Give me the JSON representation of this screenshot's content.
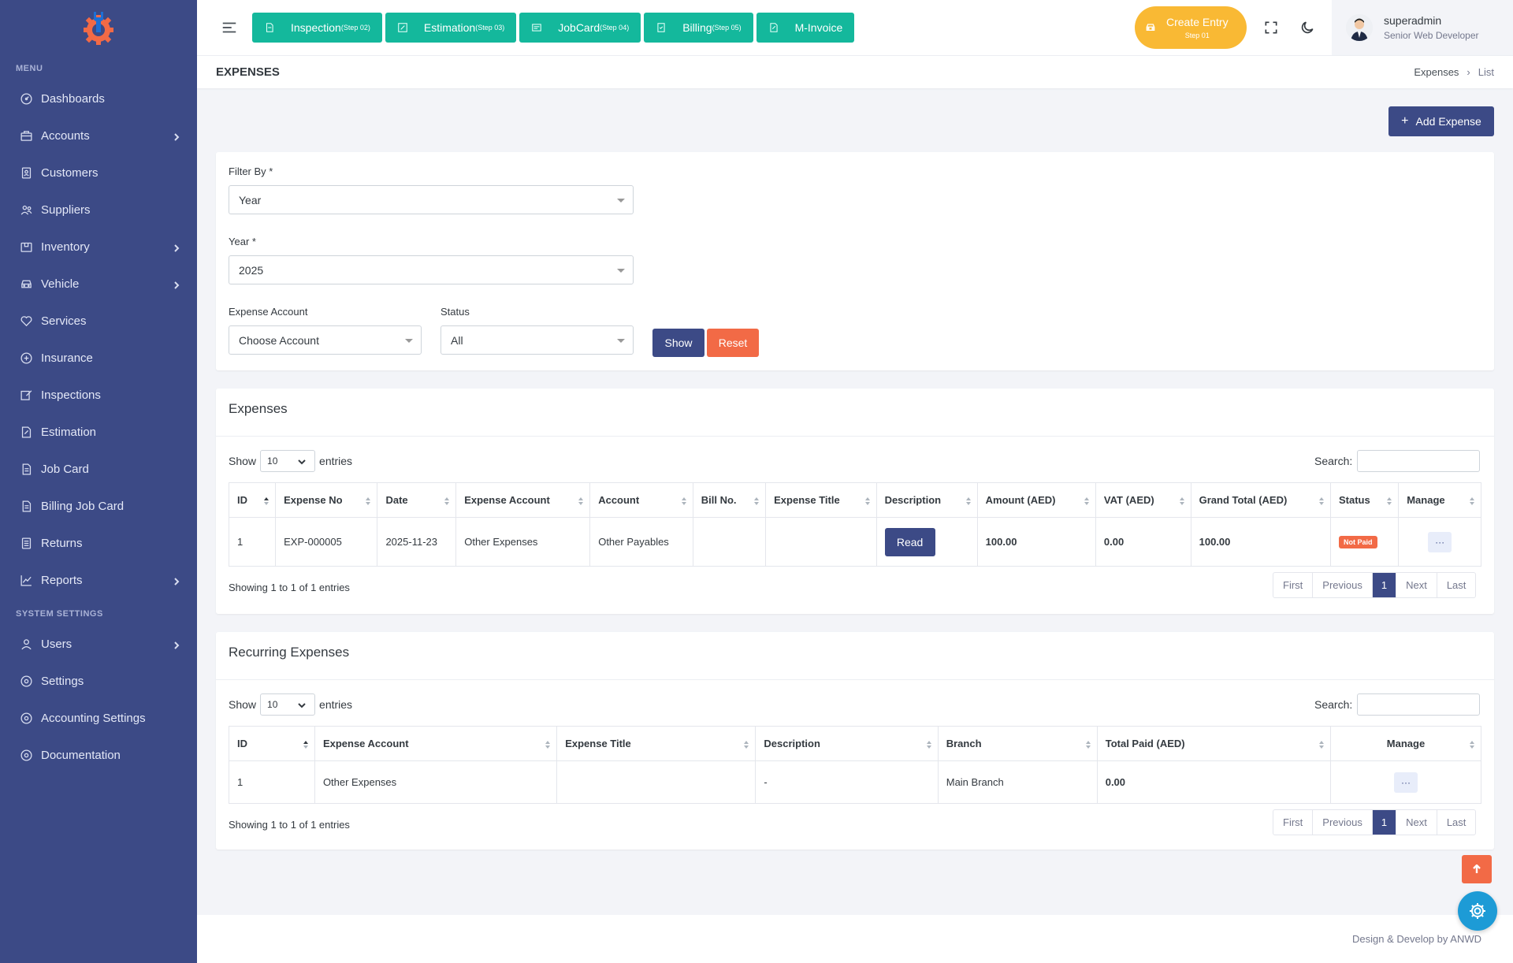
{
  "sidebar": {
    "menu_title": "MENU",
    "system_title": "SYSTEM SETTINGS",
    "items": [
      {
        "label": "Dashboards",
        "icon": "dashboard-icon",
        "has_sub": false
      },
      {
        "label": "Accounts",
        "icon": "briefcase-icon",
        "has_sub": true
      },
      {
        "label": "Customers",
        "icon": "contact-book-icon",
        "has_sub": false
      },
      {
        "label": "Suppliers",
        "icon": "users-group-icon",
        "has_sub": false
      },
      {
        "label": "Inventory",
        "icon": "box-icon",
        "has_sub": true
      },
      {
        "label": "Vehicle",
        "icon": "car-icon",
        "has_sub": true
      },
      {
        "label": "Services",
        "icon": "heart-icon",
        "has_sub": false
      },
      {
        "label": "Insurance",
        "icon": "insurance-icon",
        "has_sub": false
      },
      {
        "label": "Inspections",
        "icon": "edit-box-icon",
        "has_sub": false
      },
      {
        "label": "Estimation",
        "icon": "edit-note-icon",
        "has_sub": false
      },
      {
        "label": "Job Card",
        "icon": "document-icon",
        "has_sub": false
      },
      {
        "label": "Billing Job Card",
        "icon": "document-icon",
        "has_sub": false
      },
      {
        "label": "Returns",
        "icon": "list-icon",
        "has_sub": false
      },
      {
        "label": "Reports",
        "icon": "chart-line-icon",
        "has_sub": true
      }
    ],
    "system_items": [
      {
        "label": "Users",
        "icon": "user-icon",
        "has_sub": true
      },
      {
        "label": "Settings",
        "icon": "settings-icon",
        "has_sub": false
      },
      {
        "label": "Accounting Settings",
        "icon": "settings-icon",
        "has_sub": false
      },
      {
        "label": "Documentation",
        "icon": "settings-icon",
        "has_sub": false
      }
    ]
  },
  "topbar": {
    "steps": [
      {
        "label": "Inspection",
        "step": "(Step 02)"
      },
      {
        "label": "Estimation",
        "step": "(Step 03)"
      },
      {
        "label": "JobCard",
        "step": "(Step 04)"
      },
      {
        "label": "Billing",
        "step": "(Step 05)"
      },
      {
        "label": "M-Invoice",
        "step": ""
      }
    ],
    "create_entry": "Create Entry",
    "create_entry_step": "Step 01",
    "user_name": "superadmin",
    "user_role": "Senior Web Developer"
  },
  "page": {
    "title": "EXPENSES",
    "breadcrumb_parent": "Expenses",
    "breadcrumb_current": "List",
    "add_label": "Add Expense"
  },
  "filter": {
    "filter_by_label": "Filter By *",
    "filter_by_value": "Year",
    "year_label": "Year *",
    "year_value": "2025",
    "account_label": "Expense Account",
    "account_value": "Choose Account",
    "status_label": "Status",
    "status_value": "All",
    "show_label": "Show",
    "reset_label": "Reset"
  },
  "expenses": {
    "title": "Expenses",
    "show_label": "Show",
    "show_value": "10",
    "entries_label": "entries",
    "search_label": "Search:",
    "columns": [
      "ID",
      "Expense No",
      "Date",
      "Expense Account",
      "Account",
      "Bill No.",
      "Expense Title",
      "Description",
      "Amount (AED)",
      "VAT (AED)",
      "Grand Total (AED)",
      "Status",
      "Manage"
    ],
    "rows": [
      {
        "id": "1",
        "expense_no": "EXP-000005",
        "date": "2025-11-23",
        "expense_account": "Other Expenses",
        "account": "Other Payables",
        "bill_no": "",
        "expense_title": "",
        "description_btn": "Read",
        "amount": "100.00",
        "vat": "0.00",
        "grand_total": "100.00",
        "status": "Not Paid",
        "manage": "···"
      }
    ],
    "showing": "Showing 1 to 1 of 1 entries",
    "pager": [
      "First",
      "Previous",
      "1",
      "Next",
      "Last"
    ]
  },
  "recurring": {
    "title": "Recurring Expenses",
    "show_label": "Show",
    "show_value": "10",
    "entries_label": "entries",
    "search_label": "Search:",
    "columns": [
      "ID",
      "Expense Account",
      "Expense Title",
      "Description",
      "Branch",
      "Total Paid (AED)",
      "Manage"
    ],
    "rows": [
      {
        "id": "1",
        "expense_account": "Other Expenses",
        "expense_title": "",
        "description": "-",
        "branch": "Main Branch",
        "total_paid": "0.00",
        "manage": "···"
      }
    ],
    "showing": "Showing 1 to 1 of 1 entries",
    "pager": [
      "First",
      "Previous",
      "1",
      "Next",
      "Last"
    ]
  },
  "footer": {
    "text": "Design & Develop by ANWD"
  },
  "colors": {
    "sidebar": "#3c4a86",
    "step_button": "#14b89c",
    "create_entry": "#f9b934",
    "accent": "#3c4a86",
    "danger": "#f26a46"
  }
}
